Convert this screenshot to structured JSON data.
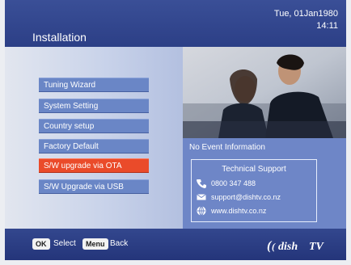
{
  "header": {
    "title": "Installation",
    "date": "Tue, 01Jan1980",
    "time": "14:11"
  },
  "menu": {
    "items": [
      {
        "label": "Tuning Wizard",
        "selected": false
      },
      {
        "label": "System Setting",
        "selected": false
      },
      {
        "label": "Country setup",
        "selected": false
      },
      {
        "label": "Factory Default",
        "selected": false
      },
      {
        "label": "S/W upgrade via OTA",
        "selected": true
      },
      {
        "label": "S/W Upgrade via USB",
        "selected": false
      }
    ]
  },
  "info": {
    "event_text": "No Event Information",
    "support": {
      "title": "Technical Support",
      "phone": "0800 347 488",
      "email": "support@dishtv.co.nz",
      "website": "www.dishtv.co.nz"
    }
  },
  "footer": {
    "ok_key": "OK",
    "ok_label": "Select",
    "menu_key": "Menu",
    "menu_label": "Back",
    "brand": "dishTV"
  },
  "colors": {
    "header_blue": "#2c3f86",
    "menu_blue": "#6a86c6",
    "selected_orange": "#ea4b2a",
    "info_blue": "#6e86c7"
  },
  "icons": {
    "phone": "phone-icon",
    "email": "email-icon",
    "website": "globe-icon"
  }
}
